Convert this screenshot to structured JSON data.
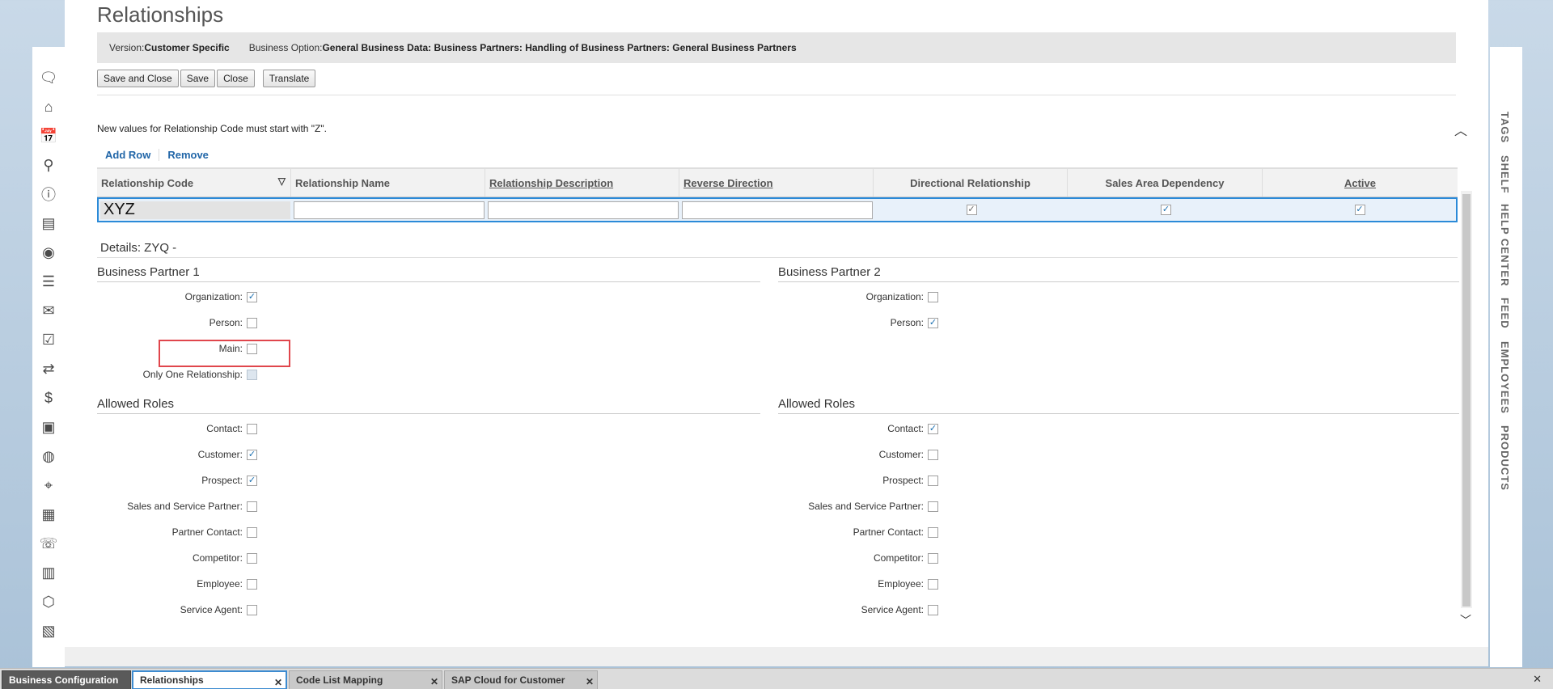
{
  "page": {
    "title": "Relationships",
    "version_label": "Version:",
    "version_value": "Customer Specific",
    "business_option_label": "Business Option:",
    "business_option_value": "General Business Data: Business Partners: Handling of Business Partners: General Business Partners"
  },
  "toolbar": {
    "save_close": "Save and Close",
    "save": "Save",
    "close": "Close",
    "translate": "Translate"
  },
  "hint": "New values for Relationship Code must start with \"Z\".",
  "table_actions": {
    "add_row": "Add Row",
    "remove": "Remove"
  },
  "grid": {
    "columns": [
      "Relationship Code",
      "Relationship Name",
      "Relationship Description",
      "Reverse Direction",
      "Directional Relationship",
      "Sales Area Dependency",
      "Active"
    ],
    "row": {
      "code": "XYZ",
      "name": "",
      "description": "",
      "reverse": "",
      "directional": true,
      "sales_area": true,
      "active": true
    }
  },
  "details": {
    "title": "Details: ZYQ -",
    "bp1": {
      "title": "Business Partner 1",
      "fields": [
        {
          "label": "Organization:",
          "checked": true
        },
        {
          "label": "Person:",
          "checked": false
        },
        {
          "label": "Main:",
          "checked": false
        },
        {
          "label": "Only One Relationship:",
          "checked": false,
          "disabled": true
        }
      ],
      "roles_title": "Allowed Roles",
      "roles": [
        {
          "label": "Contact:",
          "checked": false
        },
        {
          "label": "Customer:",
          "checked": true
        },
        {
          "label": "Prospect:",
          "checked": true
        },
        {
          "label": "Sales and Service Partner:",
          "checked": false
        },
        {
          "label": "Partner Contact:",
          "checked": false
        },
        {
          "label": "Competitor:",
          "checked": false
        },
        {
          "label": "Employee:",
          "checked": false
        },
        {
          "label": "Service Agent:",
          "checked": false
        }
      ]
    },
    "bp2": {
      "title": "Business Partner 2",
      "fields": [
        {
          "label": "Organization:",
          "checked": false
        },
        {
          "label": "Person:",
          "checked": true
        }
      ],
      "roles_title": "Allowed Roles",
      "roles": [
        {
          "label": "Contact:",
          "checked": true
        },
        {
          "label": "Customer:",
          "checked": false
        },
        {
          "label": "Prospect:",
          "checked": false
        },
        {
          "label": "Sales and Service Partner:",
          "checked": false
        },
        {
          "label": "Partner Contact:",
          "checked": false
        },
        {
          "label": "Competitor:",
          "checked": false
        },
        {
          "label": "Employee:",
          "checked": false
        },
        {
          "label": "Service Agent:",
          "checked": false
        }
      ]
    }
  },
  "right_tabs": [
    "TAGS",
    "SHELF",
    "HELP CENTER",
    "FEED",
    "EMPLOYEES",
    "PRODUCTS"
  ],
  "left_icons": [
    "chat-icon",
    "home-icon",
    "calendar-icon",
    "search-icon",
    "alert-icon",
    "notebook-icon",
    "person-icon",
    "people-list-icon",
    "mail-icon",
    "checklist-icon",
    "money-transfer-icon",
    "dollar-icon",
    "person-card-icon",
    "globe-icon",
    "map-pin-icon",
    "calendar-grid-icon",
    "phone-icon",
    "clipboard-icon",
    "box-icon",
    "document-icon"
  ],
  "bottom_tabs": [
    {
      "label": "Business Configuration"
    },
    {
      "label": "Relationships"
    },
    {
      "label": "Code List Mapping"
    },
    {
      "label": "SAP Cloud for Customer"
    }
  ],
  "check_glyph": "✓"
}
